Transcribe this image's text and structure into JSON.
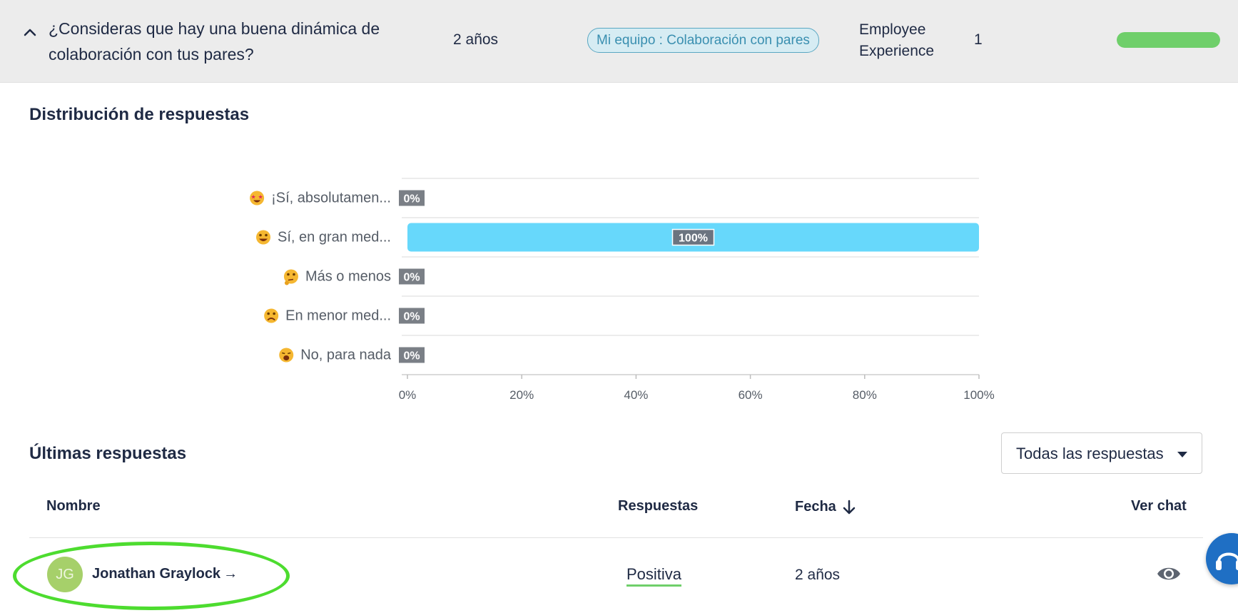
{
  "question": {
    "text": "¿Consideras que hay una buena dinámica de colaboración con tus pares?",
    "age": "2 años",
    "tag": "Mi equipo : Colaboración con pares",
    "category": "Employee Experience",
    "count": "1",
    "progress": 1.0,
    "progress_color": "#6fcf6a"
  },
  "distribution": {
    "title": "Distribución de respuestas"
  },
  "chart_data": {
    "type": "bar",
    "orientation": "horizontal",
    "categories": [
      "¡Sí, absolutamen...",
      "Sí, en gran med...",
      "Más o menos",
      "En menor med...",
      "No, para nada"
    ],
    "icons": [
      "star-struck-emoji",
      "grinning-emoji",
      "thinking-emoji",
      "frowning-emoji",
      "tired-emoji"
    ],
    "values": [
      0,
      100,
      0,
      0,
      0
    ],
    "data_labels": [
      "0%",
      "100%",
      "0%",
      "0%",
      "0%"
    ],
    "xticks": [
      "0%",
      "20%",
      "40%",
      "60%",
      "80%",
      "100%"
    ],
    "xlim": [
      0,
      100
    ],
    "bar_color": "#67d8fb",
    "grid": true
  },
  "latest": {
    "title": "Últimas respuestas",
    "filter_label": "Todas las respuestas"
  },
  "table": {
    "headers": {
      "name": "Nombre",
      "answers": "Respuestas",
      "date": "Fecha",
      "chat": "Ver chat"
    },
    "rows": [
      {
        "initials": "JG",
        "name": "Jonathan Graylock",
        "arrow": "→",
        "answer": "Positiva",
        "date": "2 años"
      }
    ]
  }
}
